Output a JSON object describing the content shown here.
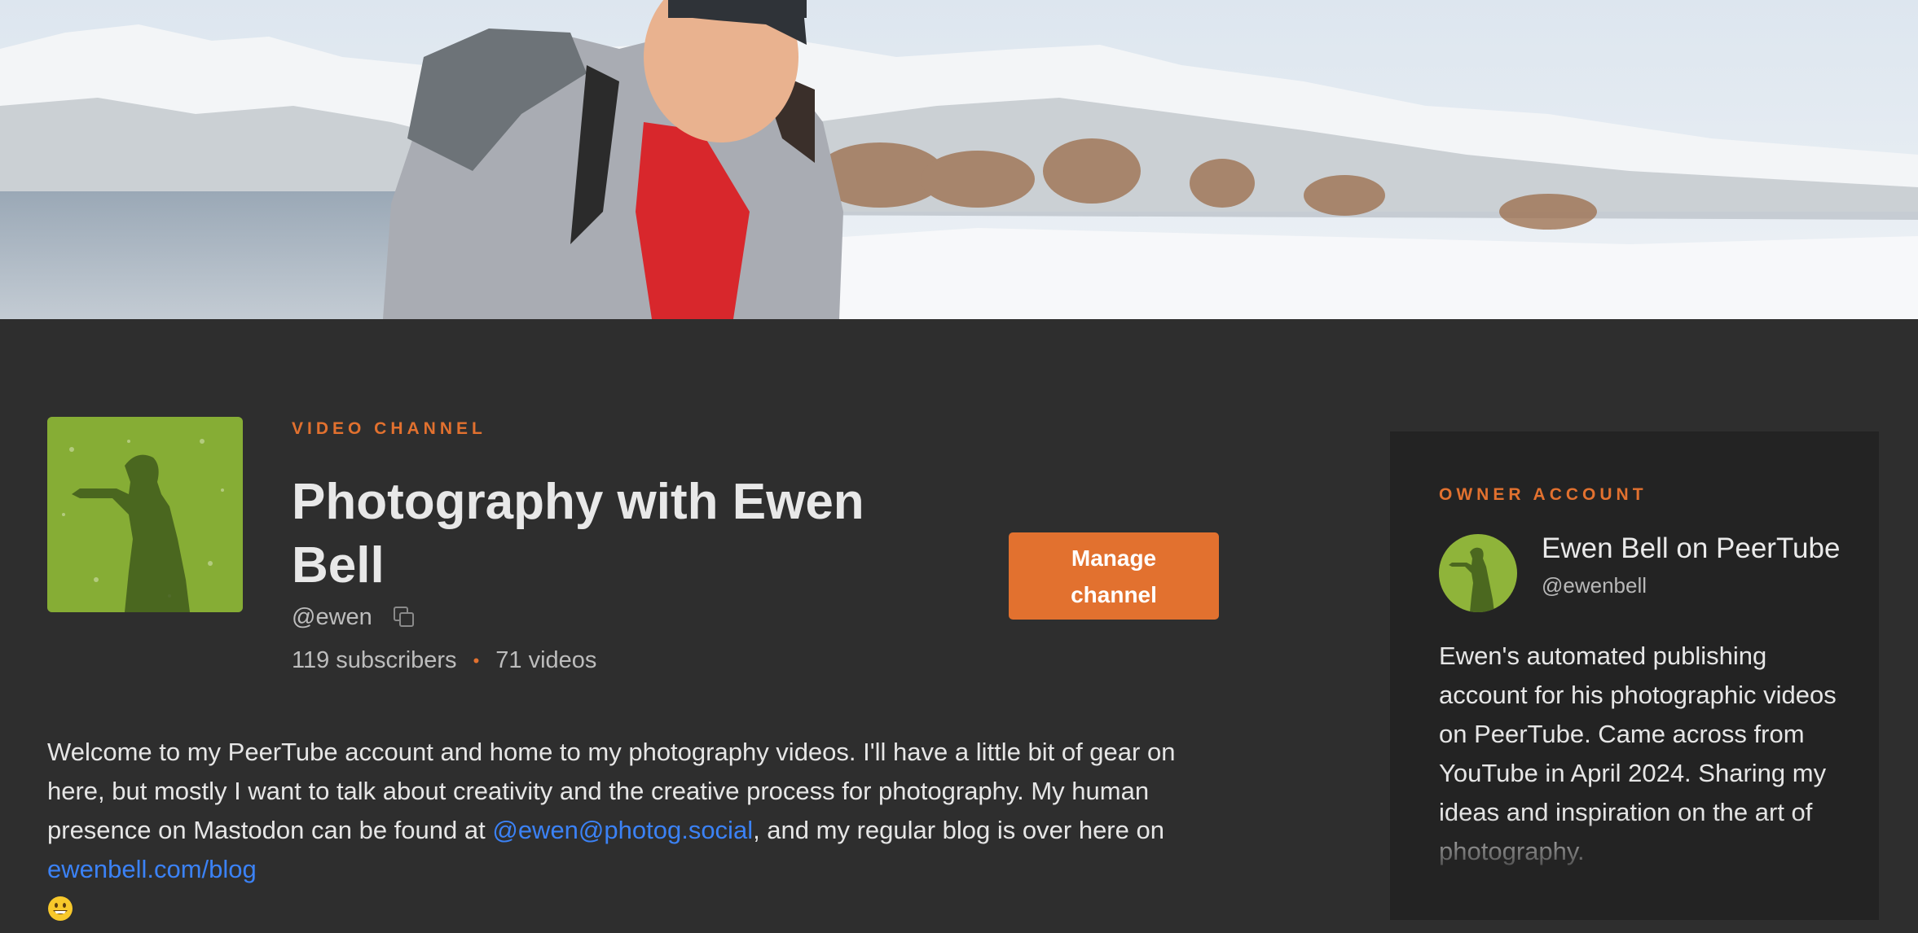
{
  "banner": {
    "alt": "Channel banner: man in a winter jacket in front of snowy mountains"
  },
  "channel": {
    "kicker": "VIDEO CHANNEL",
    "title": "Photography with Ewen Bell",
    "handle": "@ewen",
    "subscribers": "119 subscribers",
    "separator": "•",
    "videos": "71 videos",
    "manage_label": "Manage channel"
  },
  "description": {
    "text_1": "Welcome to my PeerTube account and home to my photography videos. I'll have a little bit of gear on here, but mostly I want to talk about creativity and the creative process for photography. My human presence on Mastodon can be found at ",
    "link_1": "@ewen@photog.social",
    "text_2": ", and my regular blog is over here on ",
    "link_2": "ewenbell.com/blog"
  },
  "owner": {
    "kicker": "OWNER ACCOUNT",
    "name": "Ewen Bell on PeerTube",
    "handle": "@ewenbell",
    "description": "Ewen's automated publishing account for his photographic videos on PeerTube. Came across from YouTube in April 2024. Sharing my ideas and inspiration on the art of photography."
  },
  "colors": {
    "accent": "#e2712f",
    "link": "#3b82f6",
    "background": "#2e2e2e",
    "card": "#232323"
  },
  "icons": {
    "copy": "copy-icon",
    "emoji": "grinning-face-emoji"
  }
}
